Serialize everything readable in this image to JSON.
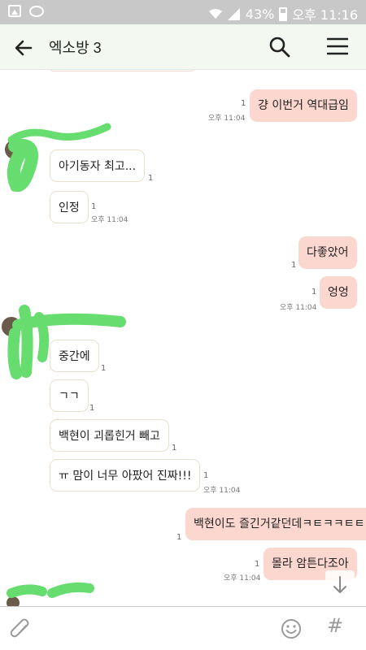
{
  "status_bar": {
    "battery": "43%",
    "time": "오후 11:16"
  },
  "header": {
    "title": "엑소방 3"
  },
  "messages": [
    {
      "text": "걍 이번거 역대급임",
      "read": "1",
      "time": "오후 11:04"
    },
    {
      "text": "아기동자 최고...",
      "read": "1"
    },
    {
      "text": "인정",
      "read": "1",
      "time": "오후 11:04"
    },
    {
      "text": "다좋았어",
      "read": "1"
    },
    {
      "text": "엉엉",
      "read": "1",
      "time": "오후 11:04"
    },
    {
      "text": "중간에",
      "read": "1"
    },
    {
      "text": "ㄱㄱ",
      "read": "1"
    },
    {
      "text": "백현이 괴롭힌거 빼고",
      "read": "1"
    },
    {
      "text": "ㅠ 맘이 너무 아팠어 진짜!!!",
      "read": "1",
      "time": "오후 11:04"
    },
    {
      "text": "백현이도 즐긴거같던데ㅋㅌㅋㅋㅌㅌㅋ",
      "read": "1"
    },
    {
      "text": "몰라 암튼다조아",
      "read": "1",
      "time": "오후 11:04"
    }
  ],
  "icons": {
    "back": "arrow-left",
    "search": "magnifier",
    "menu": "hamburger",
    "attach": "paperclip",
    "emoji": "smiley",
    "hash": "#",
    "scroll_down": "arrow-down"
  },
  "colors": {
    "my_bubble": "#fcd7d0",
    "their_bubble_border": "#eadfcf",
    "header_bg": "#f3f9f1",
    "status_bar_bg": "#c8c8c8",
    "redaction": "#66dd6e"
  }
}
